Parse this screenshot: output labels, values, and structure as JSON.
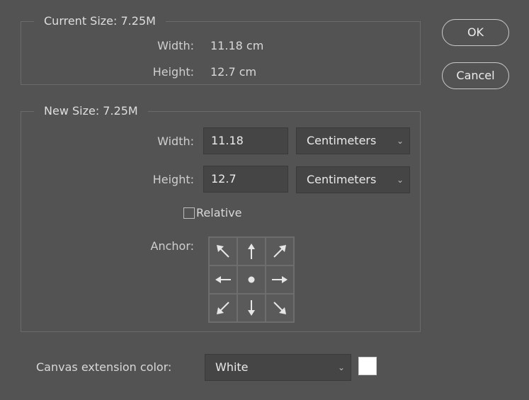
{
  "current_size": {
    "title": "Current Size: 7.25M",
    "width_label": "Width:",
    "width_value": "11.18 cm",
    "height_label": "Height:",
    "height_value": "12.7 cm"
  },
  "new_size": {
    "title": "New Size: 7.25M",
    "width_label": "Width:",
    "width_value": "11.18",
    "width_unit": "Centimeters",
    "height_label": "Height:",
    "height_value": "12.7",
    "height_unit": "Centimeters",
    "relative_label": "Relative",
    "relative_checked": false,
    "anchor_label": "Anchor:",
    "anchor_selected": "center",
    "anchor_icons": [
      "arrow-up-left-icon",
      "arrow-up-icon",
      "arrow-up-right-icon",
      "arrow-left-icon",
      "anchor-center-dot-icon",
      "arrow-right-icon",
      "arrow-down-left-icon",
      "arrow-down-icon",
      "arrow-down-right-icon"
    ]
  },
  "canvas_extension": {
    "label": "Canvas extension color:",
    "value": "White",
    "swatch_color": "#ffffff"
  },
  "buttons": {
    "ok_label": "OK",
    "cancel_label": "Cancel"
  },
  "colors": {
    "background": "#535353",
    "field_background": "#454545",
    "text": "#d6d6d6"
  }
}
